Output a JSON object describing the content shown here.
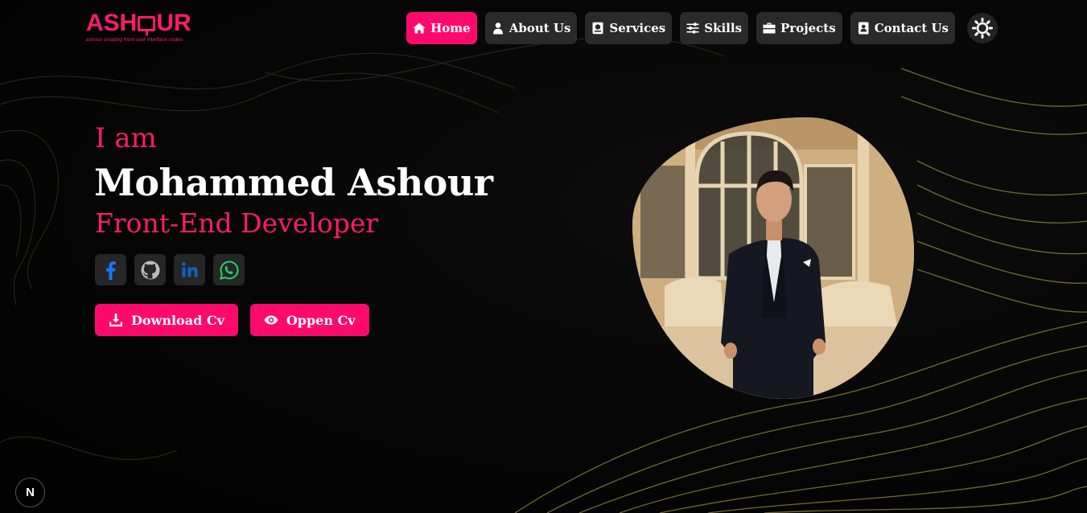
{
  "brand": {
    "logo_text_left": "ASH",
    "logo_text_right": "UR",
    "tagline": "ashour creating front user interface codes",
    "accent_color": "#ff0a6c"
  },
  "nav": {
    "items": [
      {
        "label": "Home",
        "icon": "home-icon",
        "active": true
      },
      {
        "label": "About Us",
        "icon": "user-icon",
        "active": false
      },
      {
        "label": "Services",
        "icon": "service-icon",
        "active": false
      },
      {
        "label": "Skills",
        "icon": "sliders-icon",
        "active": false
      },
      {
        "label": "Projects",
        "icon": "briefcase-icon",
        "active": false
      },
      {
        "label": "Contact Us",
        "icon": "contact-book-icon",
        "active": false
      }
    ],
    "theme_toggle_icon": "sun-icon"
  },
  "hero": {
    "intro": "I am",
    "name": "Mohammed Ashour",
    "role": "Front-End Developer",
    "socials": [
      {
        "name": "facebook",
        "icon": "facebook-icon"
      },
      {
        "name": "github",
        "icon": "github-icon"
      },
      {
        "name": "linkedin",
        "icon": "linkedin-icon"
      },
      {
        "name": "whatsapp",
        "icon": "whatsapp-icon"
      }
    ],
    "buttons": {
      "download_label": "Download Cv",
      "open_label": "Oppen Cv"
    }
  },
  "badge": {
    "label": "N"
  }
}
